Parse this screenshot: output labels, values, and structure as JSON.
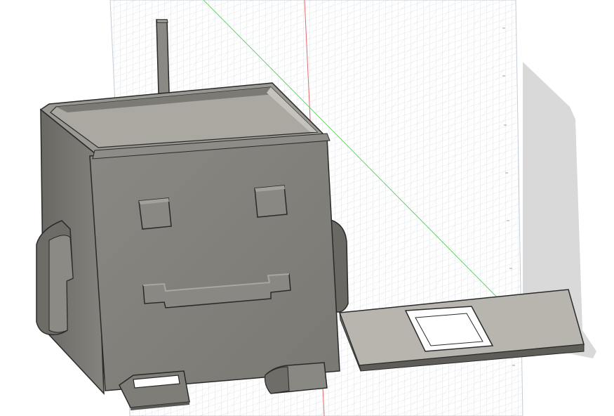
{
  "app": {
    "title": "",
    "viewport": "3d-cad-viewport"
  },
  "colors": {
    "background": "#ffffff",
    "grid_line": "#cfd6dd",
    "grid_major": "#b8c2cc",
    "axis_x": "#e05050",
    "axis_y": "#4cc24c",
    "model_face": "#8c8a84",
    "model_front": "#7f7d77",
    "model_dark": "#5e5c57",
    "model_inner": "#a7a59e",
    "edge": "#222222",
    "shadow": "#d8d8d8"
  },
  "objects": [
    {
      "name": "robot-pencil-holder-body"
    },
    {
      "name": "antenna"
    },
    {
      "name": "eye-left"
    },
    {
      "name": "eye-right"
    },
    {
      "name": "smile-mouth"
    },
    {
      "name": "arm-left"
    },
    {
      "name": "arm-right"
    },
    {
      "name": "foot-left"
    },
    {
      "name": "foot-right"
    },
    {
      "name": "flat-plate-with-cutout"
    }
  ]
}
